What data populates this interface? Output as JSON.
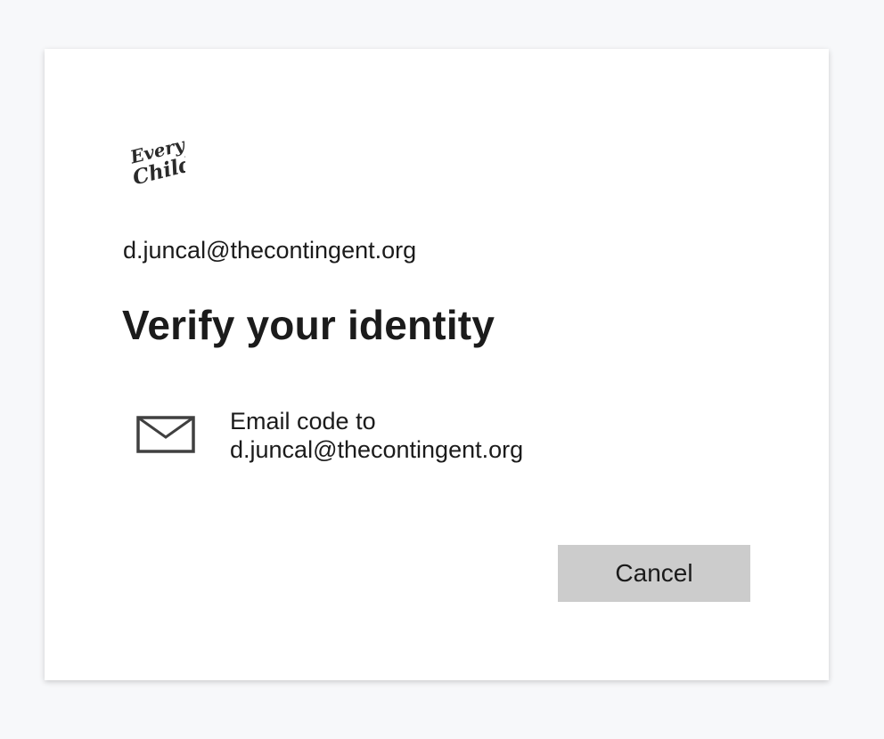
{
  "logo": {
    "name": "every-child-logo",
    "line1": "Every",
    "line2": "Child"
  },
  "account": {
    "email": "d.juncal@thecontingent.org"
  },
  "page": {
    "title": "Verify your identity"
  },
  "options": [
    {
      "icon": "mail-icon",
      "label": "Email code to",
      "detail": "d.juncal@thecontingent.org"
    }
  ],
  "actions": {
    "cancel_label": "Cancel"
  },
  "colors": {
    "background": "#f7f8fa",
    "card": "#ffffff",
    "text": "#1b1b1b",
    "button": "#cccccc",
    "icon": "#404040"
  }
}
